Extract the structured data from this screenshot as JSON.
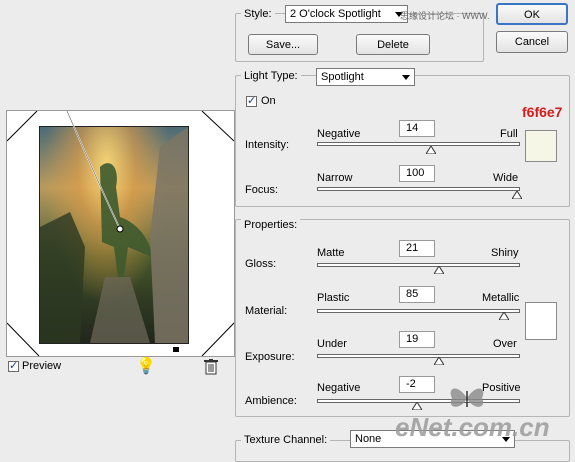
{
  "style": {
    "label": "Style:",
    "value": "2 O'clock Spotlight",
    "save": "Save...",
    "delete": "Delete"
  },
  "dialog": {
    "ok": "OK",
    "cancel": "Cancel"
  },
  "watermark": {
    "text": "思缘设计论坛 · WWW.MISSYUAN.COM"
  },
  "light": {
    "label": "Light Type:",
    "value": "Spotlight",
    "on_label": "On",
    "on": true,
    "color_hex": "f6f6e7",
    "color": "#f6f6e7",
    "intensity": {
      "label": "Intensity:",
      "min": "Negative",
      "max": "Full",
      "value": "14",
      "fraction": 0.57
    },
    "focus": {
      "label": "Focus:",
      "min": "Narrow",
      "max": "Wide",
      "value": "100",
      "fraction": 1.0
    }
  },
  "properties": {
    "label": "Properties:",
    "gloss": {
      "label": "Gloss:",
      "min": "Matte",
      "max": "Shiny",
      "value": "21",
      "fraction": 0.6
    },
    "material": {
      "label": "Material:",
      "min": "Plastic",
      "max": "Metallic",
      "value": "85",
      "fraction": 0.92
    },
    "exposure": {
      "label": "Exposure:",
      "min": "Under",
      "max": "Over",
      "value": "19",
      "fraction": 0.6
    },
    "ambience": {
      "label": "Ambience:",
      "min": "Negative",
      "max": "Positive",
      "value": "-2",
      "fraction": 0.49
    },
    "swatch_color": "#ffffff"
  },
  "texture": {
    "label": "Texture Channel:",
    "value": "None"
  },
  "preview": {
    "label": "Preview",
    "checked": true
  },
  "brand": {
    "text": "eNet.com.cn"
  }
}
